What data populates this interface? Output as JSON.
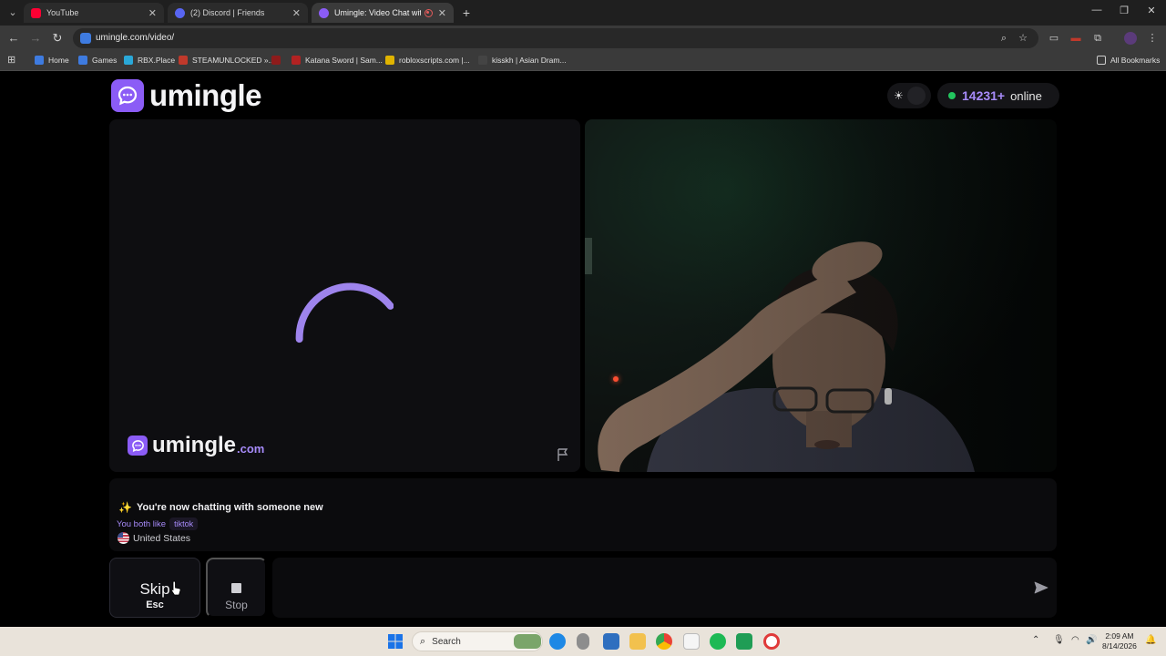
{
  "browser": {
    "tabs": [
      {
        "title": "YouTube",
        "color": "#ff0033"
      },
      {
        "title": "(2) Discord | Friends",
        "color": "#5865f2"
      },
      {
        "title": "Umingle: Video Chat with S",
        "color": "#8b5cf6"
      }
    ],
    "url": "umingle.com/video/",
    "bookmarks": [
      "Home",
      "Games",
      "RBX.Place",
      "STEAMUNLOCKED »...",
      "Katana Sword | Sam...",
      "robloxscripts.com |...",
      "kisskh | Asian Dram..."
    ],
    "all_bookmarks": "All Bookmarks"
  },
  "site": {
    "logo": "umingle",
    "online_count": "14231+",
    "online_label": "online",
    "watermark_name": "umingle",
    "watermark_tld": ".com",
    "accent": "#8b5cf6"
  },
  "chat": {
    "system_message": "You're now chatting with someone new",
    "likes_label": "You both like",
    "likes_tag": "tiktok",
    "country": "United States"
  },
  "controls": {
    "skip_label": "Skip",
    "skip_hotkey": "Esc",
    "stop_label": "Stop",
    "message_value": ""
  },
  "taskbar": {
    "search_placeholder": "Search",
    "time": "2:09 AM",
    "date": "8/14/2026"
  }
}
